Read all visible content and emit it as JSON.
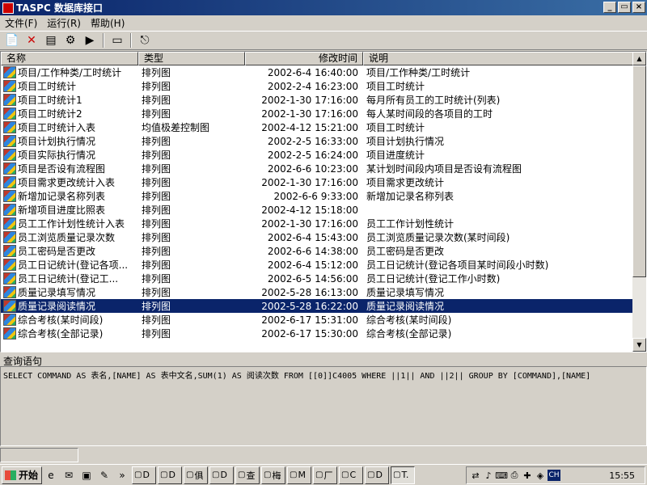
{
  "window": {
    "title": "TASPC 数据库接口",
    "btn_min": "_",
    "btn_max": "▭",
    "btn_close": "×"
  },
  "menu": [
    "文件(F)",
    "运行(R)",
    "帮助(H)"
  ],
  "toolbar": [
    "new-icon",
    "delete-icon",
    "edit-icon",
    "settings-icon",
    "run-icon",
    "window-icon",
    "exit-icon"
  ],
  "list": {
    "headers": [
      "名称",
      "类型",
      "修改时间",
      "说明"
    ],
    "rows": [
      {
        "name": "项目/工作种类/工时统计",
        "type": "排列图",
        "time": "2002-6-4 16:40:00",
        "desc": "项目/工作种类/工时统计"
      },
      {
        "name": "项目工时统计",
        "type": "排列图",
        "time": "2002-2-4 16:23:00",
        "desc": "项目工时统计"
      },
      {
        "name": "项目工时统计1",
        "type": "排列图",
        "time": "2002-1-30 17:16:00",
        "desc": "每月所有员工的工时统计(列表)"
      },
      {
        "name": "项目工时统计2",
        "type": "排列图",
        "time": "2002-1-30 17:16:00",
        "desc": "每人某时间段的各项目的工时"
      },
      {
        "name": "项目工时统计入表",
        "type": "均值极差控制图",
        "time": "2002-4-12 15:21:00",
        "desc": "项目工时统计"
      },
      {
        "name": "项目计划执行情况",
        "type": "排列图",
        "time": "2002-2-5 16:33:00",
        "desc": "项目计划执行情况"
      },
      {
        "name": "项目实际执行情况",
        "type": "排列图",
        "time": "2002-2-5 16:24:00",
        "desc": "项目进度统计"
      },
      {
        "name": "项目是否设有流程图",
        "type": "排列图",
        "time": "2002-6-6 10:23:00",
        "desc": "某计划时间段内项目是否设有流程图"
      },
      {
        "name": "项目需求更改统计入表",
        "type": "排列图",
        "time": "2002-1-30 17:16:00",
        "desc": "项目需求更改统计"
      },
      {
        "name": "新增加记录名称列表",
        "type": "排列图",
        "time": "2002-6-6 9:33:00",
        "desc": "新增加记录名称列表"
      },
      {
        "name": "新增项目进度比照表",
        "type": "排列图",
        "time": "2002-4-12 15:18:00",
        "desc": ""
      },
      {
        "name": "员工工作计划性统计入表",
        "type": "排列图",
        "time": "2002-1-30 17:16:00",
        "desc": "员工工作计划性统计"
      },
      {
        "name": "员工浏览质量记录次数",
        "type": "排列图",
        "time": "2002-6-4 15:43:00",
        "desc": "员工浏览质量记录次数(某时间段)"
      },
      {
        "name": "员工密码是否更改",
        "type": "排列图",
        "time": "2002-6-6 14:38:00",
        "desc": "员工密码是否更改"
      },
      {
        "name": "员工日记统计(登记各项...",
        "type": "排列图",
        "time": "2002-6-4 15:12:00",
        "desc": "员工日记统计(登记各项目某时间段小时数)"
      },
      {
        "name": "员工日记统计(登记工...",
        "type": "排列图",
        "time": "2002-6-5 14:56:00",
        "desc": "员工日记统计(登记工作小时数)"
      },
      {
        "name": "质量记录填写情况",
        "type": "排列图",
        "time": "2002-5-28 16:13:00",
        "desc": "质量记录填写情况"
      },
      {
        "name": "质量记录阅读情况",
        "type": "排列图",
        "time": "2002-5-28 16:22:00",
        "desc": "质量记录阅读情况",
        "selected": true
      },
      {
        "name": "综合考核(某时间段)",
        "type": "排列图",
        "time": "2002-6-17 15:31:00",
        "desc": "综合考核(某时间段)"
      },
      {
        "name": "综合考核(全部记录)",
        "type": "排列图",
        "time": "2002-6-17 15:30:00",
        "desc": "综合考核(全部记录)"
      }
    ]
  },
  "query": {
    "label": "查询语句",
    "sql": "SELECT COMMAND AS 表名,[NAME] AS 表中文名,SUM(1) AS 阅读次数 FROM [[0]]C4005 WHERE ||1|| AND  ||2|| GROUP BY [COMMAND],[NAME]"
  },
  "taskbar": {
    "start": "开始",
    "quicklaunch": [
      "ie-icon",
      "outlook-icon",
      "desktop-icon",
      "tool-icon"
    ],
    "more": "»",
    "tasks": [
      "D",
      "D",
      "俱",
      "D",
      "查",
      "梅",
      "M",
      "厂",
      "C",
      "D",
      "T."
    ],
    "clock": "15:55",
    "lang": "CH"
  }
}
